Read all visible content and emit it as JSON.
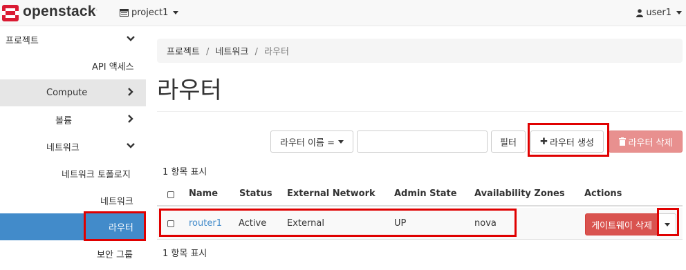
{
  "topbar": {
    "brand": "openstack",
    "trademark": ".",
    "project": "project1",
    "user": "user1"
  },
  "sidebar": {
    "items": [
      {
        "label": "프로젝트",
        "chevron": "down"
      },
      {
        "label": "API 액세스"
      },
      {
        "label": "Compute",
        "chevron": "right"
      },
      {
        "label": "볼륨",
        "chevron": "right"
      },
      {
        "label": "네트워크",
        "chevron": "down"
      },
      {
        "label": "네트워크 토폴로지"
      },
      {
        "label": "네트워크"
      },
      {
        "label": "라우터",
        "active": true
      },
      {
        "label": "보안 그룹"
      }
    ]
  },
  "breadcrumb": [
    "프로젝트",
    "네트워크",
    "라우터"
  ],
  "breadcrumb_separator": "/",
  "page_title": "라우터",
  "toolbar": {
    "filter_field": "라우터 이름 =",
    "filter_value": "",
    "filter_button": "필터",
    "create_button": "라우터 생성",
    "delete_button": "라우터 삭제"
  },
  "table": {
    "count_label": "1 항목 표시",
    "columns": [
      "Name",
      "Status",
      "External Network",
      "Admin State",
      "Availability Zones",
      "Actions"
    ],
    "rows": [
      {
        "name": "router1",
        "status": "Active",
        "external_network": "External",
        "admin_state": "UP",
        "availability_zones": "nova",
        "action": "게이트웨이 삭제"
      }
    ]
  },
  "colors": {
    "accent": "#428bca",
    "danger": "#d9534f",
    "highlight": "#e00000",
    "logo": "#da1a32"
  }
}
